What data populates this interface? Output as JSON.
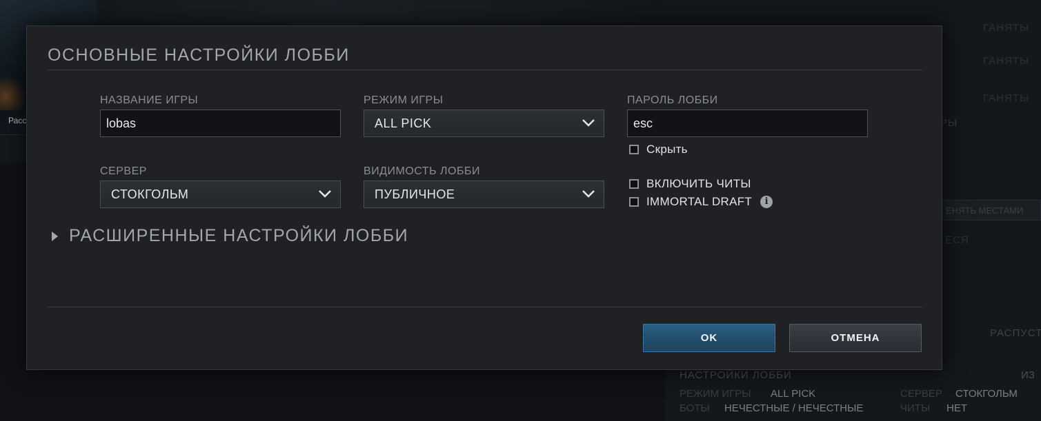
{
  "background": {
    "left_label": "Расс",
    "right_faint": [
      "ГАНЯТЫ",
      "ГАНЯТЫ",
      "ГАНЯТЫ",
      "РЫ",
      "ЕНЯТЬ МЕСТАМИ",
      "ЕСЯ",
      "РАСПУСТ"
    ],
    "lobby_settings_title": "НАСТРОЙКИ ЛОББИ",
    "lobby_settings_title_right": "ИЗ",
    "summary": {
      "mode_key": "РЕЖИМ ИГРЫ",
      "mode_val": "ALL PICK",
      "server_key": "СЕРВЕР",
      "server_val": "СТОКГОЛЬМ",
      "bots_key": "БОТЫ",
      "bots_val": "НЕЧЕСТНЫЕ / НЕЧЕСТНЫЕ",
      "cheats_key": "ЧИТЫ",
      "cheats_val": "НЕТ"
    }
  },
  "modal": {
    "title": "ОСНОВНЫЕ НАСТРОЙКИ ЛОББИ",
    "game_name": {
      "label": "НАЗВАНИЕ ИГРЫ",
      "value": "lobas"
    },
    "game_mode": {
      "label": "РЕЖИМ ИГРЫ",
      "selected": "ALL PICK"
    },
    "lobby_password": {
      "label": "ПАРОЛЬ ЛОББИ",
      "value": "esc"
    },
    "hide_password": {
      "label": "Скрыть",
      "checked": false
    },
    "server": {
      "label": "СЕРВЕР",
      "selected": "СТОКГОЛЬМ"
    },
    "visibility": {
      "label": "ВИДИМОСТЬ ЛОББИ",
      "selected": "ПУБЛИЧНОЕ"
    },
    "enable_cheats": {
      "label": "ВКЛЮЧИТЬ ЧИТЫ",
      "checked": false
    },
    "immortal_draft": {
      "label": "IMMORTAL DRAFT",
      "checked": false,
      "info_icon": "i"
    },
    "advanced_label": "РАСШИРЕННЫЕ НАСТРОЙКИ ЛОББИ",
    "ok_label": "OK",
    "cancel_label": "ОТМЕНА"
  },
  "colors": {
    "accent_ok": "#214c69",
    "panel": "#1f2125"
  }
}
